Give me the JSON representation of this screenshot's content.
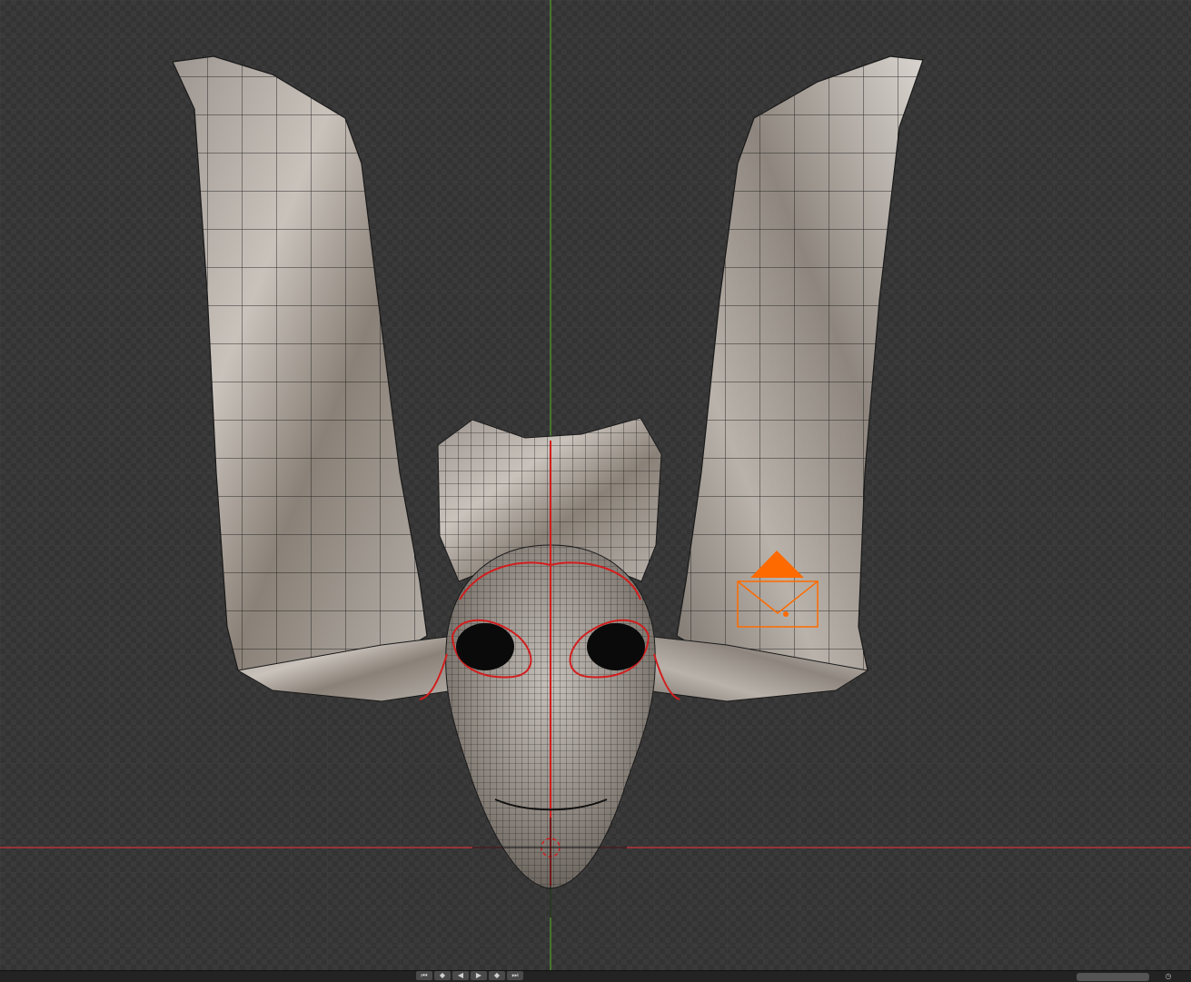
{
  "app": "3D Viewport",
  "viewport": {
    "object_name": "Mask",
    "camera_label": "camera"
  },
  "timeline": {
    "playback_buttons": [
      {
        "name": "jump-start",
        "glyph": "⏮"
      },
      {
        "name": "keyframe-prev",
        "glyph": "◆"
      },
      {
        "name": "play-reverse",
        "glyph": "◀"
      },
      {
        "name": "play",
        "glyph": "▶"
      },
      {
        "name": "keyframe-next",
        "glyph": "◆"
      },
      {
        "name": "jump-end",
        "glyph": "⏭"
      }
    ],
    "frame_field": ""
  },
  "colors": {
    "x_axis": "#b8323a",
    "y_axis": "#4f8a2c",
    "seam": "#d21d1d",
    "camera": "#ff6a00"
  }
}
